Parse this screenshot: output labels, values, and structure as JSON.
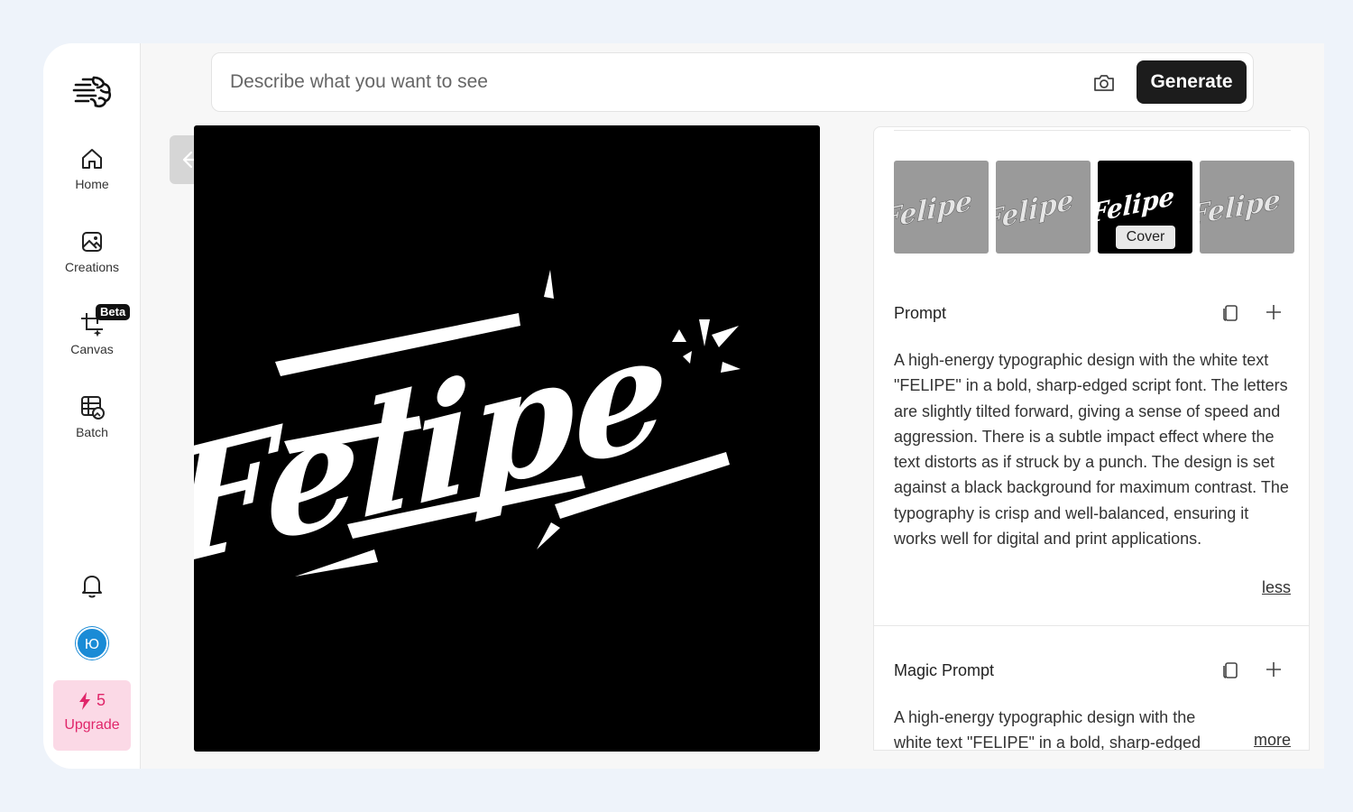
{
  "sidebar": {
    "items": [
      {
        "label": "Home",
        "icon": "home-icon"
      },
      {
        "label": "Creations",
        "icon": "image-icon"
      },
      {
        "label": "Canvas",
        "icon": "crop-sparkle-icon",
        "badge": "Beta"
      },
      {
        "label": "Batch",
        "icon": "grid-image-icon"
      }
    ],
    "avatar_initial": "Ю",
    "credits": "5",
    "upgrade_label": "Upgrade"
  },
  "search": {
    "placeholder": "Describe what you want to see",
    "generate_label": "Generate"
  },
  "image": {
    "word": "Felipe"
  },
  "thumbnails": {
    "cover_label": "Cover",
    "selected_index": 2
  },
  "prompt": {
    "title": "Prompt",
    "text": "A high-energy typographic design with the white text \"FELIPE\" in a bold, sharp-edged script font. The letters are slightly tilted forward, giving a sense of speed and aggression. There is a subtle impact effect where the text distorts as if struck by a punch. The design is set against a black background for maximum contrast. The typography is crisp and well-balanced, ensuring it works well for digital and print applications.",
    "toggle_label": "less"
  },
  "magic_prompt": {
    "title": "Magic Prompt",
    "text": "A high-energy typographic design with the white text \"FELIPE\" in a bold, sharp-edged script...",
    "toggle_label": "more"
  },
  "colors": {
    "accent_pink": "#e0266a",
    "upgrade_bg": "#fbd9e6",
    "avatar_blue": "#1a8bd6",
    "button_dark": "#1c1c1c"
  }
}
